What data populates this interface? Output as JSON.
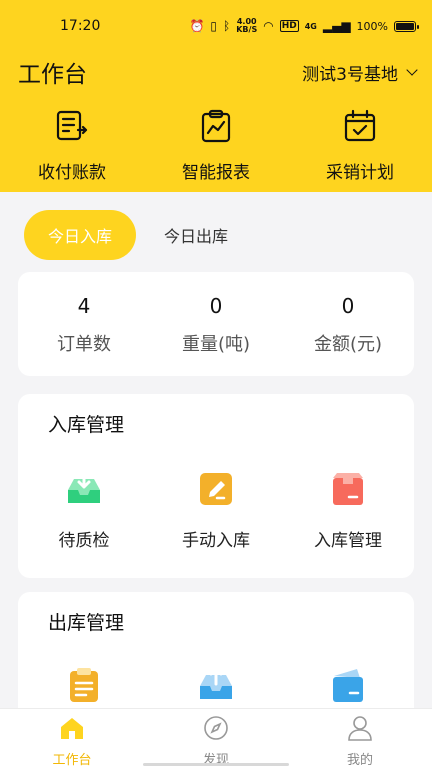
{
  "status_bar": {
    "time": "17:20",
    "speed_value": "4.00",
    "speed_unit": "KB/S",
    "hd": "HD",
    "network": "4G",
    "battery": "100%"
  },
  "header": {
    "title": "工作台",
    "base_name": "测试3号基地"
  },
  "quick_actions": [
    {
      "label": "收付账款",
      "icon": "ledger-icon"
    },
    {
      "label": "智能报表",
      "icon": "report-chart-icon"
    },
    {
      "label": "采销计划",
      "icon": "calendar-check-icon"
    }
  ],
  "tabs": [
    {
      "label": "今日入库",
      "active": true
    },
    {
      "label": "今日出库",
      "active": false
    }
  ],
  "stats": [
    {
      "value": "4",
      "label": "订单数"
    },
    {
      "value": "0",
      "label": "重量(吨)"
    },
    {
      "value": "0",
      "label": "金额(元)"
    }
  ],
  "inbound": {
    "title": "入库管理",
    "items": [
      {
        "label": "待质检",
        "icon": "inbox-download-icon"
      },
      {
        "label": "手动入库",
        "icon": "edit-pencil-icon"
      },
      {
        "label": "入库管理",
        "icon": "box-icon"
      }
    ]
  },
  "outbound": {
    "title": "出库管理",
    "items": [
      {
        "label": "",
        "icon": "clipboard-icon"
      },
      {
        "label": "",
        "icon": "inbox-upload-icon"
      },
      {
        "label": "",
        "icon": "wallet-card-icon"
      }
    ]
  },
  "bottom_nav": [
    {
      "label": "工作台",
      "icon": "home-icon",
      "active": true
    },
    {
      "label": "发现",
      "icon": "compass-icon",
      "active": false
    },
    {
      "label": "我的",
      "icon": "user-icon",
      "active": false
    }
  ],
  "colors": {
    "brand_yellow": "#fed41f",
    "nav_active": "#f2b705",
    "green_icon": "#3fd68a",
    "orange_icon": "#f0a51e",
    "red_icon": "#f76a5c",
    "blue_icon": "#3aa4e8"
  }
}
